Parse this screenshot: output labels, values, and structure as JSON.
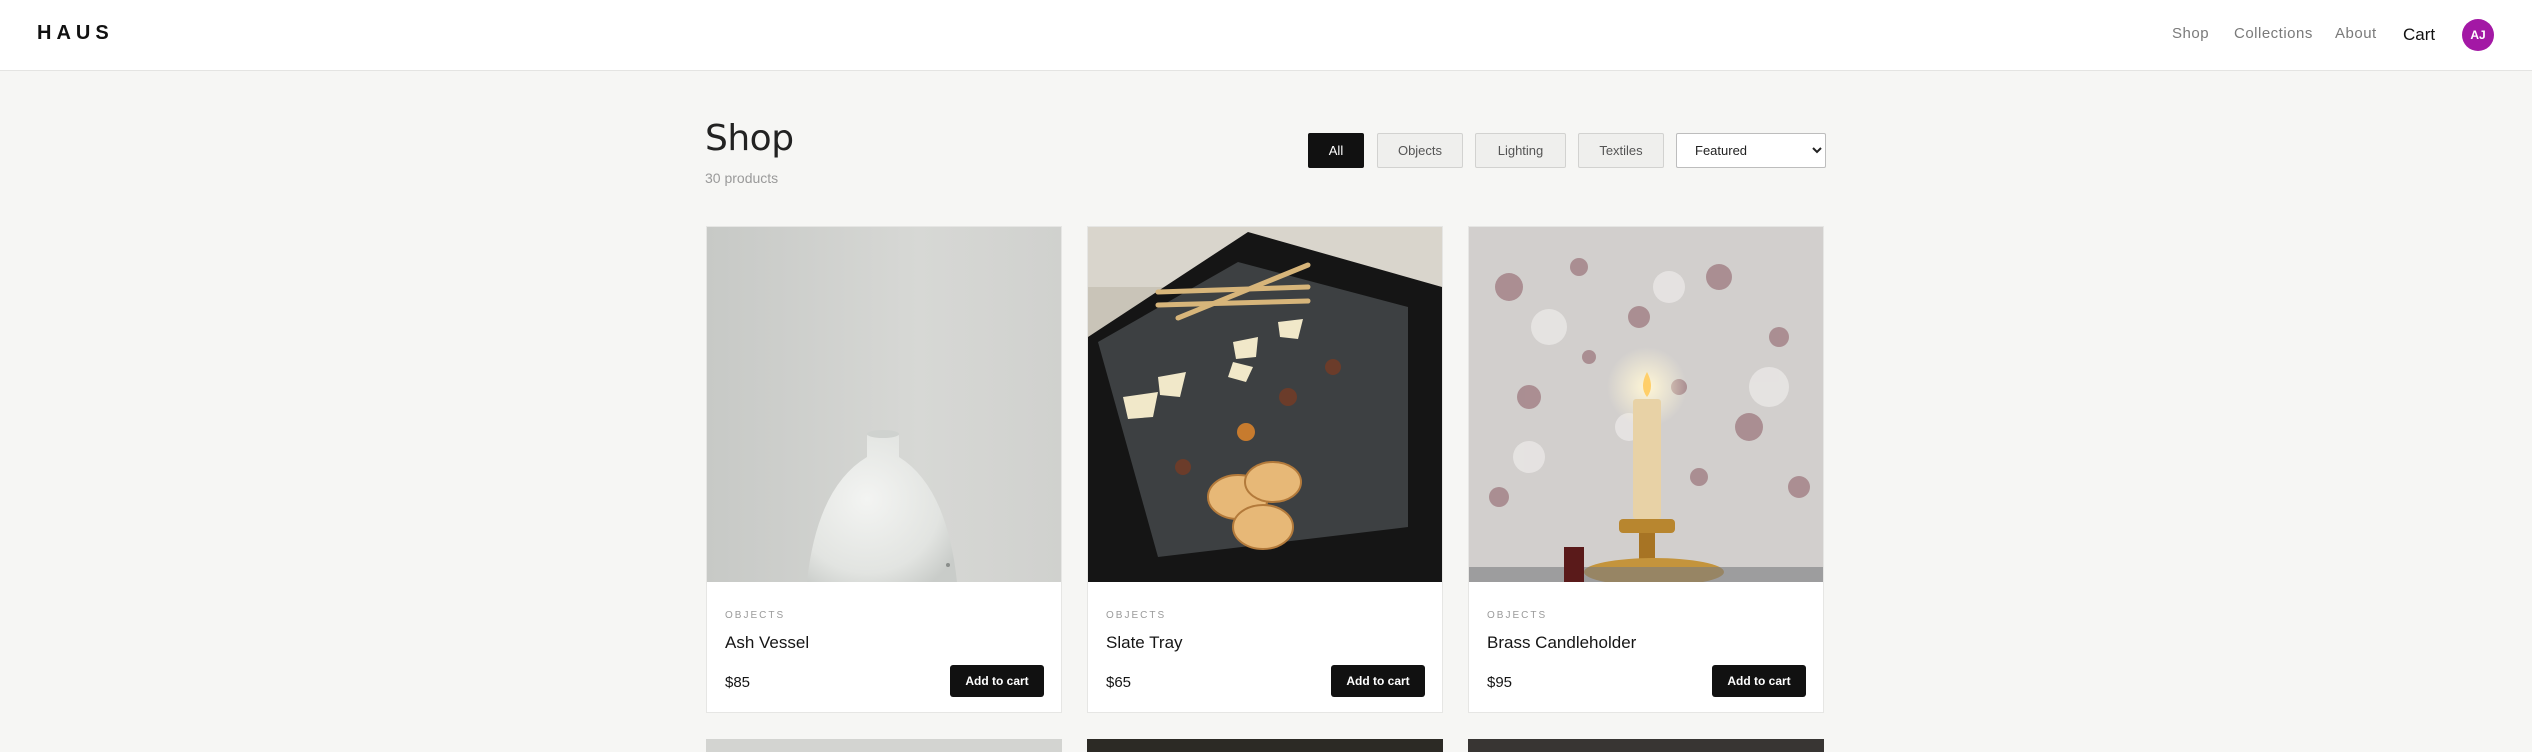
{
  "header": {
    "logo": "HAUS",
    "nav": [
      "Shop",
      "Collections",
      "About"
    ],
    "cart_label": "Cart",
    "avatar_initials": "AJ",
    "avatar_color": "#a318a5"
  },
  "main": {
    "title": "Shop",
    "product_count": "30 products",
    "filters": [
      {
        "label": "All",
        "active": true
      },
      {
        "label": "Objects",
        "active": false
      },
      {
        "label": "Lighting",
        "active": false
      },
      {
        "label": "Textiles",
        "active": false
      }
    ],
    "sort": {
      "selected": "Featured"
    },
    "products": [
      {
        "category": "OBJECTS",
        "name": "Ash Vessel",
        "price": "$85",
        "button": "Add to cart",
        "image": "white-ceramic-vase-photo"
      },
      {
        "category": "OBJECTS",
        "name": "Slate Tray",
        "price": "$65",
        "button": "Add to cart",
        "image": "cheese-on-slate-tray-photo"
      },
      {
        "category": "OBJECTS",
        "name": "Brass Candleholder",
        "price": "$95",
        "button": "Add to cart",
        "image": "lit-candle-in-brass-holder-photo"
      }
    ]
  },
  "colors": {
    "accent": "#111111",
    "background": "#f6f6f4"
  }
}
